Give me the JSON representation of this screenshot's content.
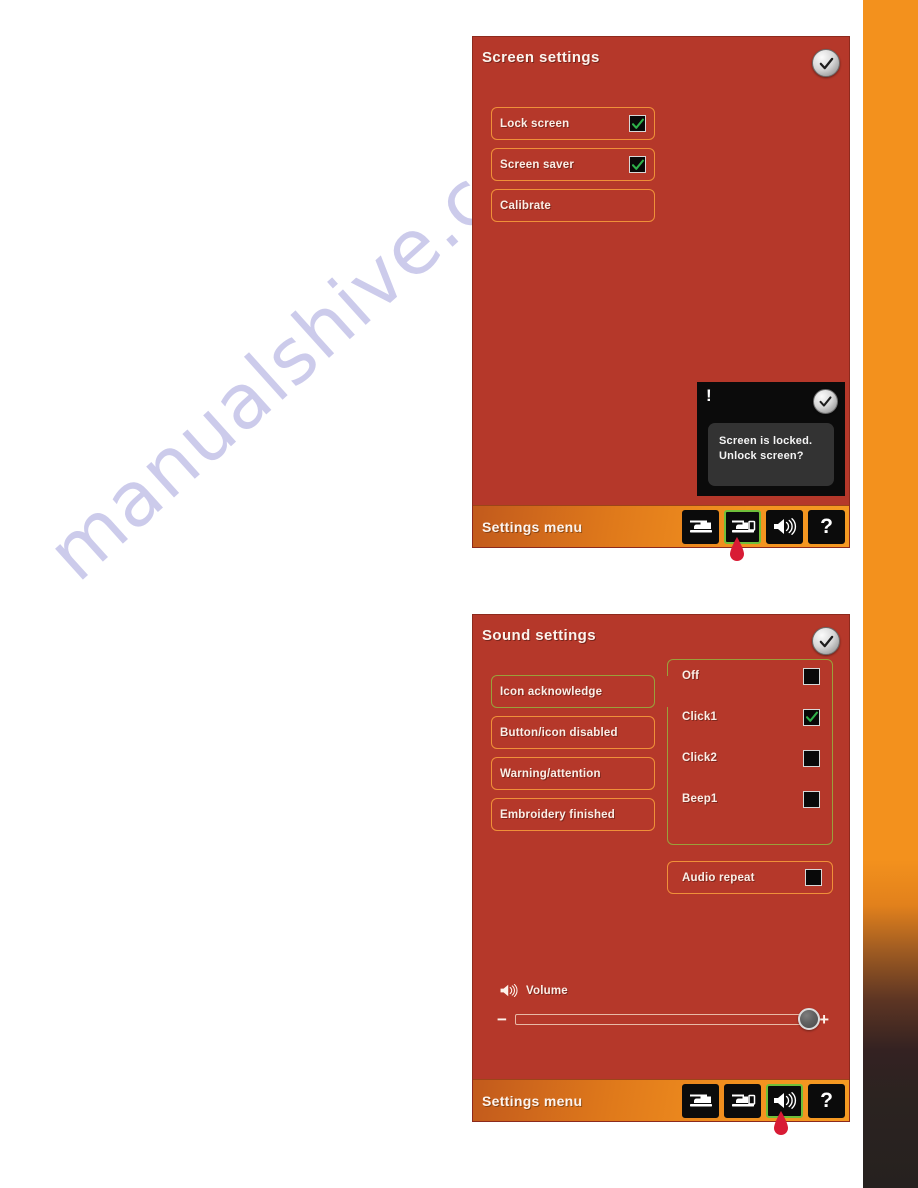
{
  "watermark": {
    "text": "manualshive.com"
  },
  "screens": [
    {
      "id": "screen-settings",
      "title": "Screen settings",
      "ok_icon": "check-icon",
      "options": [
        {
          "label": "Lock screen",
          "checked": true,
          "has_checkbox": true
        },
        {
          "label": "Screen saver",
          "checked": true,
          "has_checkbox": true
        },
        {
          "label": "Calibrate",
          "checked": false,
          "has_checkbox": false
        }
      ],
      "dialog": {
        "alert_mark": "!",
        "line1": "Screen is locked.",
        "line2": "Unlock screen?",
        "ok_icon": "check-icon"
      },
      "settings_bar": {
        "title": "Settings menu",
        "buttons": [
          {
            "icon": "sewing-machine-icon",
            "name": "machine-settings-button",
            "selected": false
          },
          {
            "icon": "screen-machine-icon",
            "name": "screen-settings-button",
            "selected": true
          },
          {
            "icon": "speaker-icon",
            "name": "sound-settings-button",
            "selected": false
          },
          {
            "icon": "question-mark-icon",
            "name": "help-button",
            "selected": false,
            "glyph": "?"
          }
        ]
      }
    },
    {
      "id": "sound-settings",
      "title": "Sound settings",
      "ok_icon": "check-icon",
      "options": [
        {
          "label": "Icon acknowledge",
          "selected": true
        },
        {
          "label": "Button/icon disabled",
          "selected": false
        },
        {
          "label": "Warning/attention",
          "selected": false
        },
        {
          "label": "Embroidery finished",
          "selected": false
        }
      ],
      "choices": [
        {
          "label": "Off",
          "checked": false
        },
        {
          "label": "Click1",
          "checked": true
        },
        {
          "label": "Click2",
          "checked": false
        },
        {
          "label": "Beep1",
          "checked": false
        }
      ],
      "audio_repeat": {
        "label": "Audio repeat",
        "checked": false
      },
      "volume": {
        "icon": "speaker-icon",
        "label": "Volume",
        "minus": "−",
        "plus": "+",
        "value": 100
      },
      "settings_bar": {
        "title": "Settings menu",
        "buttons": [
          {
            "icon": "sewing-machine-icon",
            "name": "machine-settings-button",
            "selected": false
          },
          {
            "icon": "screen-machine-icon",
            "name": "screen-settings-button",
            "selected": false
          },
          {
            "icon": "speaker-icon",
            "name": "sound-settings-button",
            "selected": true
          },
          {
            "icon": "question-mark-icon",
            "name": "help-button",
            "selected": false,
            "glyph": "?"
          }
        ]
      }
    }
  ],
  "callouts": [
    {
      "name": "callout-drop-screen",
      "color": "#d81b35"
    },
    {
      "name": "callout-drop-sound",
      "color": "#d81b35"
    }
  ],
  "colors": {
    "screen_bg": "#b5382a",
    "option_border": "#f09039",
    "selected_border": "#9aa03b",
    "bar_orange": "#f3921f",
    "check_green": "#2fb24a",
    "callout_red": "#d81b35",
    "watermark": "#b9b8e4"
  }
}
